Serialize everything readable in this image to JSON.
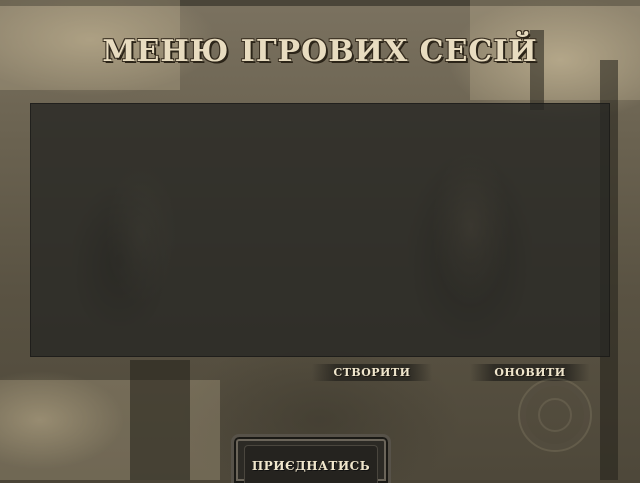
{
  "menu": {
    "title": "МЕНЮ ІГРОВИХ СЕСІЙ"
  },
  "buttons": {
    "create": "СТВОРИТИ",
    "refresh": "ОНОВИТИ",
    "join": "ПРИЄДНАТИСЬ"
  },
  "session_list": [],
  "colors": {
    "title_text": "#e8dcc0",
    "panel_bg": "#282825",
    "button_text": "#f0e6cc",
    "background_sepia": "#6a6250"
  },
  "icons": {
    "emblem": "emblem-seal-icon"
  }
}
